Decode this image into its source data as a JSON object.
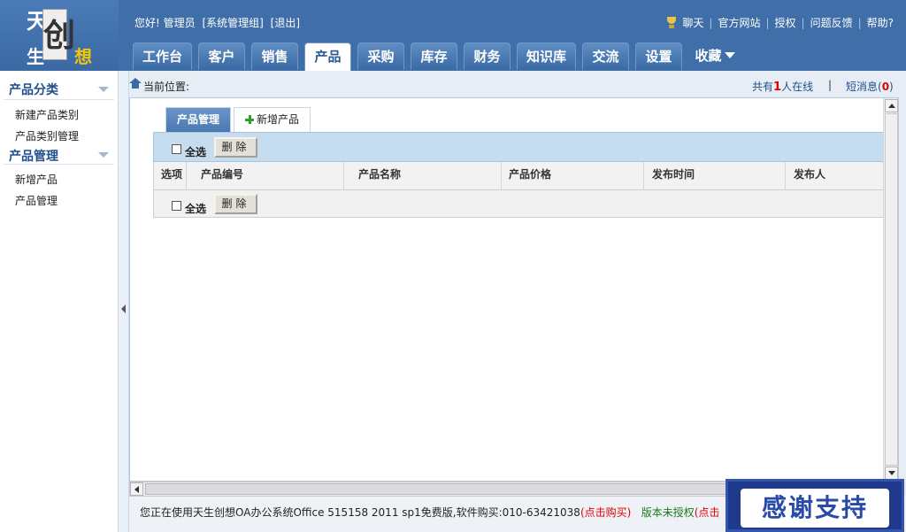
{
  "logo": {
    "c1": "天",
    "c2": "创",
    "c3": "生",
    "c4": "想"
  },
  "greeting": {
    "hello": "您好! 管理员",
    "group": "[系统管理组]",
    "logout": "[退出]"
  },
  "top_links": [
    "聊天",
    "官方网站",
    "授权",
    "问题反馈",
    "帮助?"
  ],
  "nav": {
    "tabs": [
      "工作台",
      "客户",
      "销售",
      "产品",
      "采购",
      "库存",
      "财务",
      "知识库",
      "交流",
      "设置"
    ],
    "active_index": 3,
    "favorites": "收藏"
  },
  "sidebar": {
    "section1": {
      "title": "产品分类",
      "items": [
        "新建产品类别",
        "产品类别管理"
      ]
    },
    "section2": {
      "title": "产品管理",
      "items": [
        "新增产品",
        "产品管理"
      ]
    }
  },
  "breadcrumb": {
    "label": "当前位置:"
  },
  "status": {
    "online_prefix": "共有",
    "online_count": "1",
    "online_suffix": "人在线",
    "sep": "|",
    "msg_prefix": "短消息(",
    "msg_count": "0",
    "msg_suffix": ")"
  },
  "inner_tabs": {
    "active": "产品管理",
    "add": "新增产品"
  },
  "table": {
    "select_all": "全选",
    "delete": "删除",
    "columns": [
      "选项",
      "产品编号",
      "产品名称",
      "产品价格",
      "发布时间",
      "发布人"
    ]
  },
  "footer": {
    "text": "您正在使用天生创想OA办公系统Office 515158 2011 sp1免费版,软件购买:010-63421038",
    "buy_open": "(",
    "buy": "点击购买",
    "buy_close": ")",
    "license": "版本未授权",
    "license_open": "(",
    "license_link": "点击"
  },
  "thanks": "感谢支持",
  "colors": {
    "header_bg": "#3f6ea8",
    "accent_red": "#dd0000",
    "link_blue": "#1f4f8c"
  }
}
